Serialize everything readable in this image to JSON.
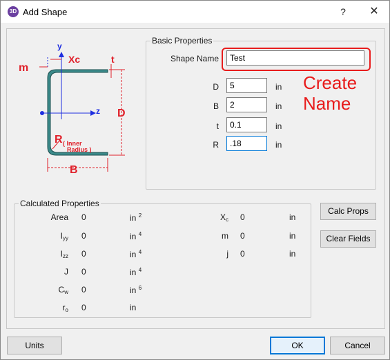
{
  "window": {
    "title": "Add Shape",
    "app_icon_text": "3D",
    "help_glyph": "?",
    "close_glyph": "✕"
  },
  "diagram": {
    "labels": {
      "m": "m",
      "y": "y",
      "xc": "Xc",
      "t": "t",
      "z": "z",
      "d": "D",
      "r": "R",
      "inner": "( Inner",
      "radius": "Radius )",
      "b": "B"
    },
    "colors": {
      "steel": "#3b8a8a",
      "annotation": "#e0202a",
      "axis": "#1e2ee0"
    }
  },
  "basic": {
    "legend": "Basic Properties",
    "shape_name_label": "Shape Name",
    "shape_name_value": "Test",
    "fields": [
      {
        "label": "D",
        "value": "5",
        "unit": "in"
      },
      {
        "label": "B",
        "value": "2",
        "unit": "in"
      },
      {
        "label": "t",
        "value": "0.1",
        "unit": "in"
      },
      {
        "label": "R",
        "value": ".18",
        "unit": "in"
      }
    ]
  },
  "annotation": {
    "text": "Create Name",
    "color": "#e81c1c"
  },
  "calc": {
    "legend": "Calculated Properties",
    "left": [
      {
        "label": "Area",
        "sub": "",
        "value": "0",
        "unit": "in",
        "unit_sup": "2"
      },
      {
        "label": "I",
        "sub": "yy",
        "value": "0",
        "unit": "in",
        "unit_sup": "4"
      },
      {
        "label": "I",
        "sub": "zz",
        "value": "0",
        "unit": "in",
        "unit_sup": "4"
      },
      {
        "label": "J",
        "sub": "",
        "value": "0",
        "unit": "in",
        "unit_sup": "4"
      },
      {
        "label": "C",
        "sub": "w",
        "value": "0",
        "unit": "in",
        "unit_sup": "6"
      },
      {
        "label": "r",
        "sub": "o",
        "value": "0",
        "unit": "in",
        "unit_sup": ""
      }
    ],
    "right": [
      {
        "label": "X",
        "sub": "c",
        "value": "0",
        "unit": "in"
      },
      {
        "label": "m",
        "sub": "",
        "value": "0",
        "unit": "in"
      },
      {
        "label": "j",
        "sub": "",
        "value": "0",
        "unit": "in"
      }
    ]
  },
  "buttons": {
    "calc_props": "Calc Props",
    "clear_fields": "Clear Fields",
    "units": "Units",
    "ok": "OK",
    "cancel": "Cancel"
  }
}
